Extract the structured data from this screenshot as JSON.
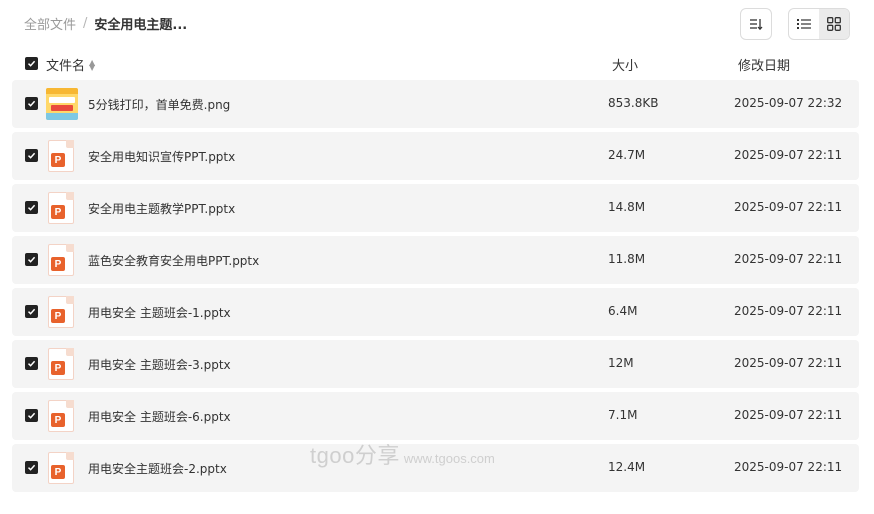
{
  "breadcrumb": {
    "root": "全部文件",
    "separator": "/",
    "current": "安全用电主题..."
  },
  "columns": {
    "name": "文件名",
    "size": "大小",
    "date": "修改日期"
  },
  "files": [
    {
      "name": "5分钱打印，首单免费.png",
      "size": "853.8KB",
      "date": "2025-09-07 22:32",
      "type": "image"
    },
    {
      "name": "安全用电知识宣传PPT.pptx",
      "size": "24.7M",
      "date": "2025-09-07 22:11",
      "type": "pptx",
      "icon_letter": "P"
    },
    {
      "name": "安全用电主题教学PPT.pptx",
      "size": "14.8M",
      "date": "2025-09-07 22:11",
      "type": "pptx",
      "icon_letter": "P"
    },
    {
      "name": "蓝色安全教育安全用电PPT.pptx",
      "size": "11.8M",
      "date": "2025-09-07 22:11",
      "type": "pptx",
      "icon_letter": "P"
    },
    {
      "name": "用电安全 主题班会-1.pptx",
      "size": "6.4M",
      "date": "2025-09-07 22:11",
      "type": "pptx",
      "icon_letter": "P"
    },
    {
      "name": "用电安全 主题班会-3.pptx",
      "size": "12M",
      "date": "2025-09-07 22:11",
      "type": "pptx",
      "icon_letter": "P"
    },
    {
      "name": "用电安全 主题班会-6.pptx",
      "size": "7.1M",
      "date": "2025-09-07 22:11",
      "type": "pptx",
      "icon_letter": "P"
    },
    {
      "name": "用电安全主题班会-2.pptx",
      "size": "12.4M",
      "date": "2025-09-07 22:11",
      "type": "pptx",
      "icon_letter": "P"
    }
  ],
  "watermark": {
    "brand": "tgoo分享",
    "url": "www.tgoos.com"
  },
  "colors": {
    "checkbox": "#222222",
    "row_bg": "#f4f4f4",
    "ppt_accent": "#e8622c",
    "active_view_bg": "#ebebeb"
  },
  "icons": {
    "sort": "sort-icon",
    "list_view": "list-view-icon",
    "grid_view": "grid-view-icon",
    "check": "check-icon"
  }
}
